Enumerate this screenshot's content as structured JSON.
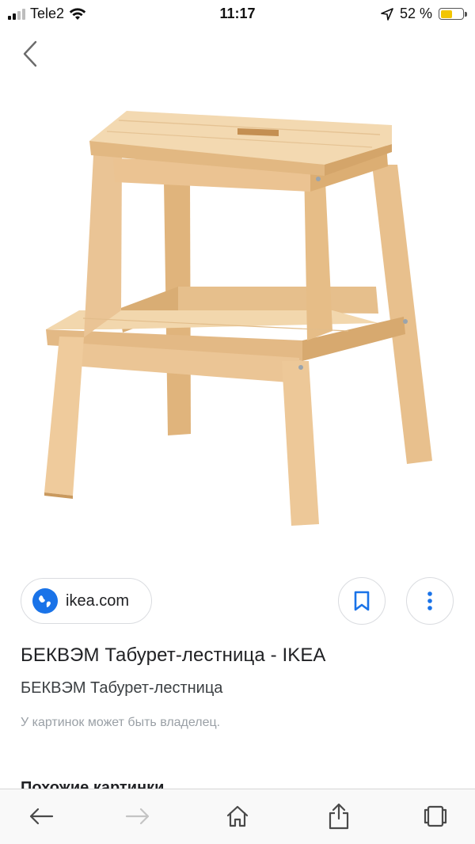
{
  "status_bar": {
    "carrier": "Tele2",
    "time": "11:17",
    "battery_percent": "52 %",
    "battery_level": 0.52,
    "signal_bars_active": 2,
    "signal_bars_total": 4
  },
  "nav": {
    "back_icon": "chevron-left-icon"
  },
  "image": {
    "subject": "wooden-step-stool"
  },
  "source": {
    "domain": "ikea.com",
    "icon": "globe-icon"
  },
  "actions": {
    "save_icon": "bookmark-icon",
    "more_icon": "more-vertical-icon"
  },
  "result": {
    "title": "БЕКВЭМ Табурет-лестница - IKEA",
    "subtitle": "БЕКВЭМ Табурет-лестница",
    "owner_note": "У картинок может быть владелец."
  },
  "similar": {
    "heading": "Похожие картинки"
  },
  "toolbar": {
    "items": [
      "back-arrow-icon",
      "forward-arrow-icon",
      "home-icon",
      "share-icon",
      "tabs-icon"
    ]
  },
  "colors": {
    "accent": "#1a73e8",
    "battery": "#f2c500",
    "wood_light": "#f0d2a6",
    "wood_mid": "#e3bb86",
    "wood_dark": "#c9995e"
  }
}
